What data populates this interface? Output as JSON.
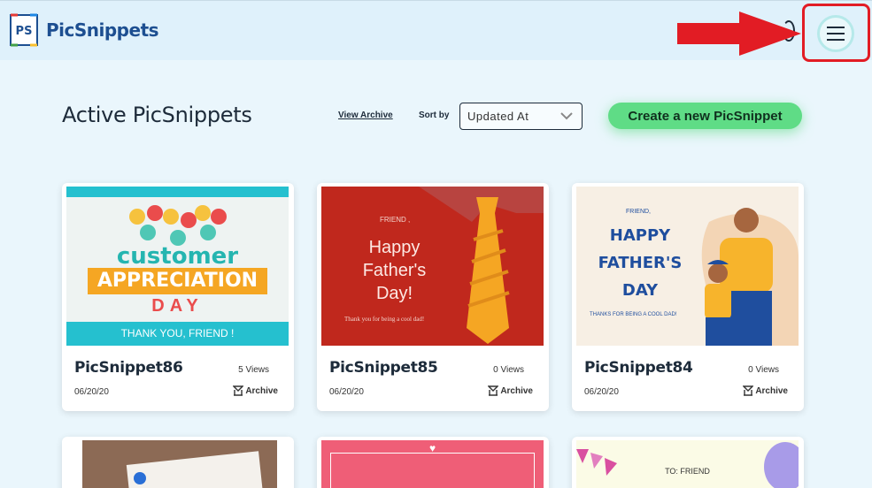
{
  "header": {
    "brand": "PicSnippets",
    "logo_initials": "PS",
    "menu_icon": "hamburger-icon",
    "annotation_color": "#e21c24"
  },
  "main": {
    "title": "Active PicSnippets",
    "view_archive_label": "View Archive",
    "sort_label": "Sort by",
    "sort_value": "Updated At",
    "create_label": "Create a new PicSnippet",
    "accent": "#5fdc86"
  },
  "cards": [
    {
      "name": "PicSnippet86",
      "views": "5 Views",
      "date": "06/20/20",
      "archive_label": "Archive",
      "thumb": {
        "line1": "customer",
        "line2": "APPRECIATION",
        "line3": "DAY",
        "footer": "THANK YOU,  FRIEND !"
      }
    },
    {
      "name": "PicSnippet85",
      "views": "0 Views",
      "date": "06/20/20",
      "archive_label": "Archive",
      "thumb": {
        "small": "FRIEND ,",
        "line1": "Happy",
        "line2": "Father's",
        "line3": "Day!",
        "footer": "Thank you for being a cool dad!"
      }
    },
    {
      "name": "PicSnippet84",
      "views": "0 Views",
      "date": "06/20/20",
      "archive_label": "Archive",
      "thumb": {
        "small": "FRIEND,",
        "line1": "HAPPY",
        "line2": "FATHER'S",
        "line3": "DAY",
        "footer": "THANKS FOR BEING A COOL DAD!"
      }
    }
  ],
  "partial_cards": [
    {
      "thumb_text": ""
    },
    {
      "thumb_text": "♥"
    },
    {
      "thumb_text": "TO: FRIEND"
    }
  ]
}
